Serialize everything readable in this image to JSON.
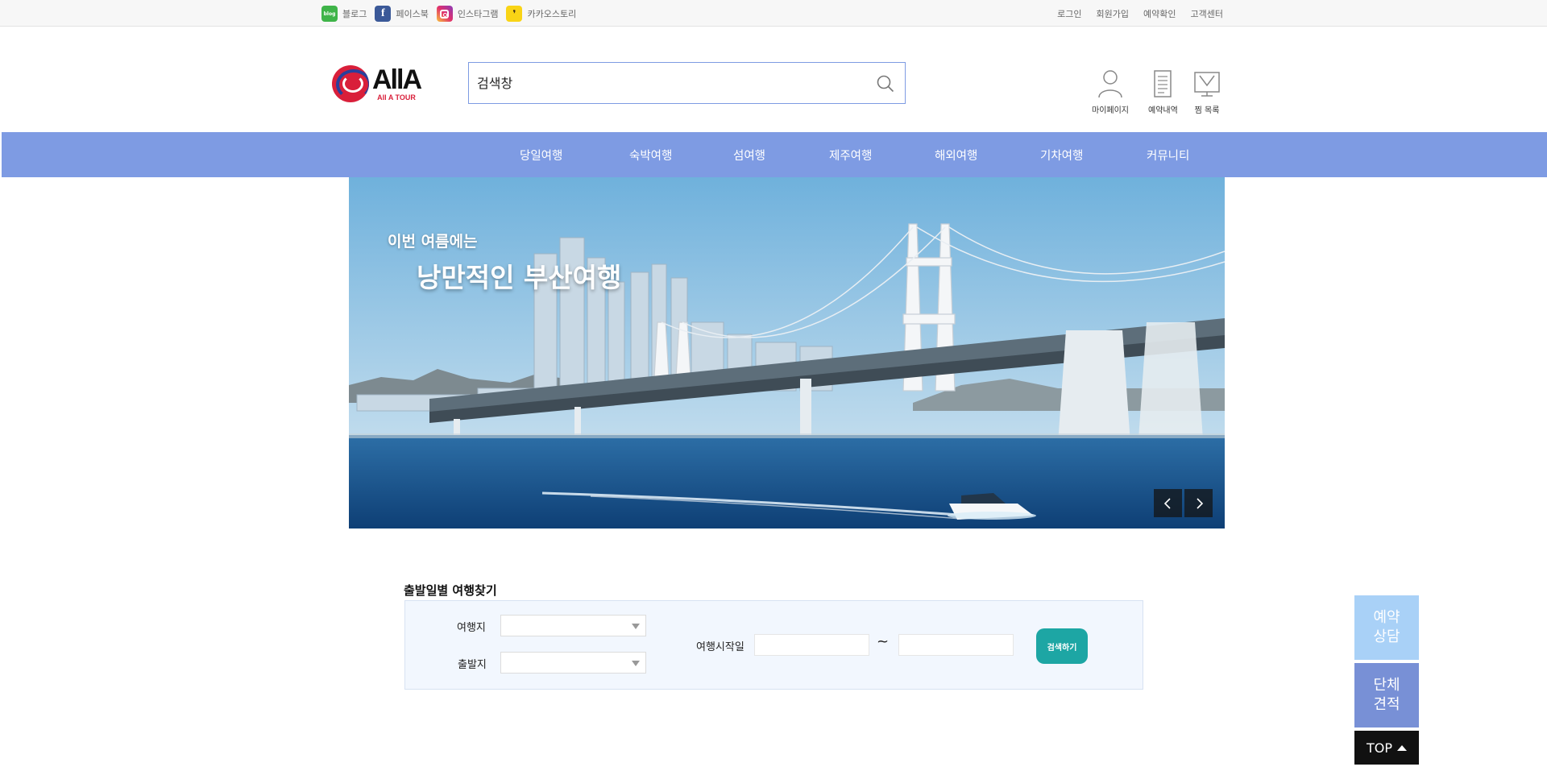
{
  "topbar": {
    "sns": [
      {
        "label": "블로그",
        "icon": "blog-icon",
        "badge": "blog"
      },
      {
        "label": "페이스북",
        "icon": "facebook-icon",
        "badge": "f"
      },
      {
        "label": "인스타그램",
        "icon": "instagram-icon"
      },
      {
        "label": "카카오스토리",
        "icon": "kakaostory-icon"
      }
    ],
    "util": [
      "로그인",
      "회원가입",
      "예약확인",
      "고객센터"
    ]
  },
  "header": {
    "logo": {
      "main": "AllA",
      "sub": "All A TOUR"
    },
    "search": {
      "placeholder": "검색창"
    },
    "icons": [
      {
        "label": "마이페이지",
        "icon": "user-icon"
      },
      {
        "label": "예약내역",
        "icon": "document-icon"
      },
      {
        "label": "찜 목록",
        "icon": "wishlist-icon"
      }
    ]
  },
  "nav": [
    "당일여행",
    "숙박여행",
    "섬여행",
    "제주여행",
    "해외여행",
    "기차여행",
    "커뮤니티"
  ],
  "banner": {
    "line1": "이번 여름에는",
    "line2": "낭만적인 부산여행"
  },
  "finder": {
    "title": "출발일별 여행찾기",
    "destination_label": "여행지",
    "departure_label": "출발지",
    "date_label": "여행시작일",
    "tilde": "~",
    "search_button": "검색하기"
  },
  "floating": {
    "reservation": "예약\n상담",
    "group": "단체\n견적",
    "top": "TOP"
  },
  "colors": {
    "nav": "#7e9be3",
    "search_button": "#1da6a4",
    "reservation": "#a9d1f7",
    "group": "#7890d6"
  }
}
